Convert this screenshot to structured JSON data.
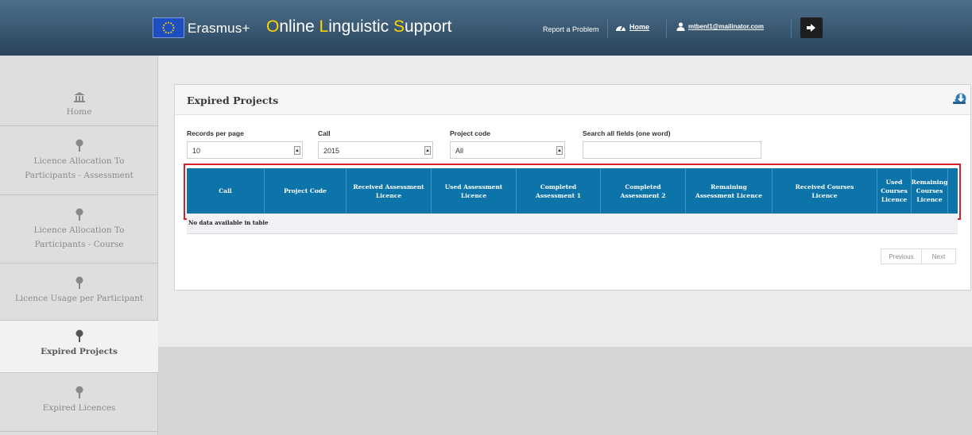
{
  "header": {
    "brand": "Erasmus+",
    "app_title_parts": [
      {
        "cap": "O",
        "rest": "nline "
      },
      {
        "cap": "L",
        "rest": "inguistic "
      },
      {
        "cap": "S",
        "rest": "upport"
      }
    ],
    "report_problem": "Report a Problem",
    "home": "Home",
    "user_email": "mtbenl1@mailinator.com"
  },
  "sidebar": {
    "items": [
      {
        "label_lines": [
          "Home"
        ],
        "icon": "home-icon",
        "active": false
      },
      {
        "label_lines": [
          "Licence Allocation To",
          "Participants - Assessment"
        ],
        "icon": "pin-icon",
        "active": false
      },
      {
        "label_lines": [
          "Licence Allocation To",
          "Participants - Course"
        ],
        "icon": "pin-icon",
        "active": false
      },
      {
        "label_lines": [
          "Licence Usage per Participant"
        ],
        "icon": "pin-icon",
        "active": false
      },
      {
        "label_lines": [
          "Expired Projects"
        ],
        "icon": "pin-icon",
        "active": true
      },
      {
        "label_lines": [
          "Expired Licences"
        ],
        "icon": "pin-icon",
        "active": false
      }
    ]
  },
  "panel": {
    "title": "Expired Projects",
    "filters": {
      "records_label": "Records per page",
      "records_value": "10",
      "call_label": "Call",
      "call_value": "2015",
      "project_label": "Project code",
      "project_value": "All",
      "search_label": "Search all fields (one word)",
      "search_value": ""
    },
    "table": {
      "columns": [
        [
          "Call"
        ],
        [
          "Project Code"
        ],
        [
          "Received Assessment",
          "Licence"
        ],
        [
          "Used Assessment",
          "Licence"
        ],
        [
          "Completed",
          "Assessment 1"
        ],
        [
          "Completed",
          "Assessment 2"
        ],
        [
          "Remaining",
          "Assessment Licence"
        ],
        [
          "Received Courses",
          "Licence"
        ],
        [
          "Used",
          "Courses",
          "Licence"
        ],
        [
          "Remaining",
          "Courses",
          "Licence"
        ]
      ],
      "empty_message": "No data available in table"
    },
    "pagination": {
      "previous": "Previous",
      "next": "Next"
    }
  },
  "colors": {
    "header_bg": "#2e4a62",
    "accent_yellow": "#ffd400",
    "table_header": "#0d74a9",
    "highlight_border": "#d61f26"
  }
}
